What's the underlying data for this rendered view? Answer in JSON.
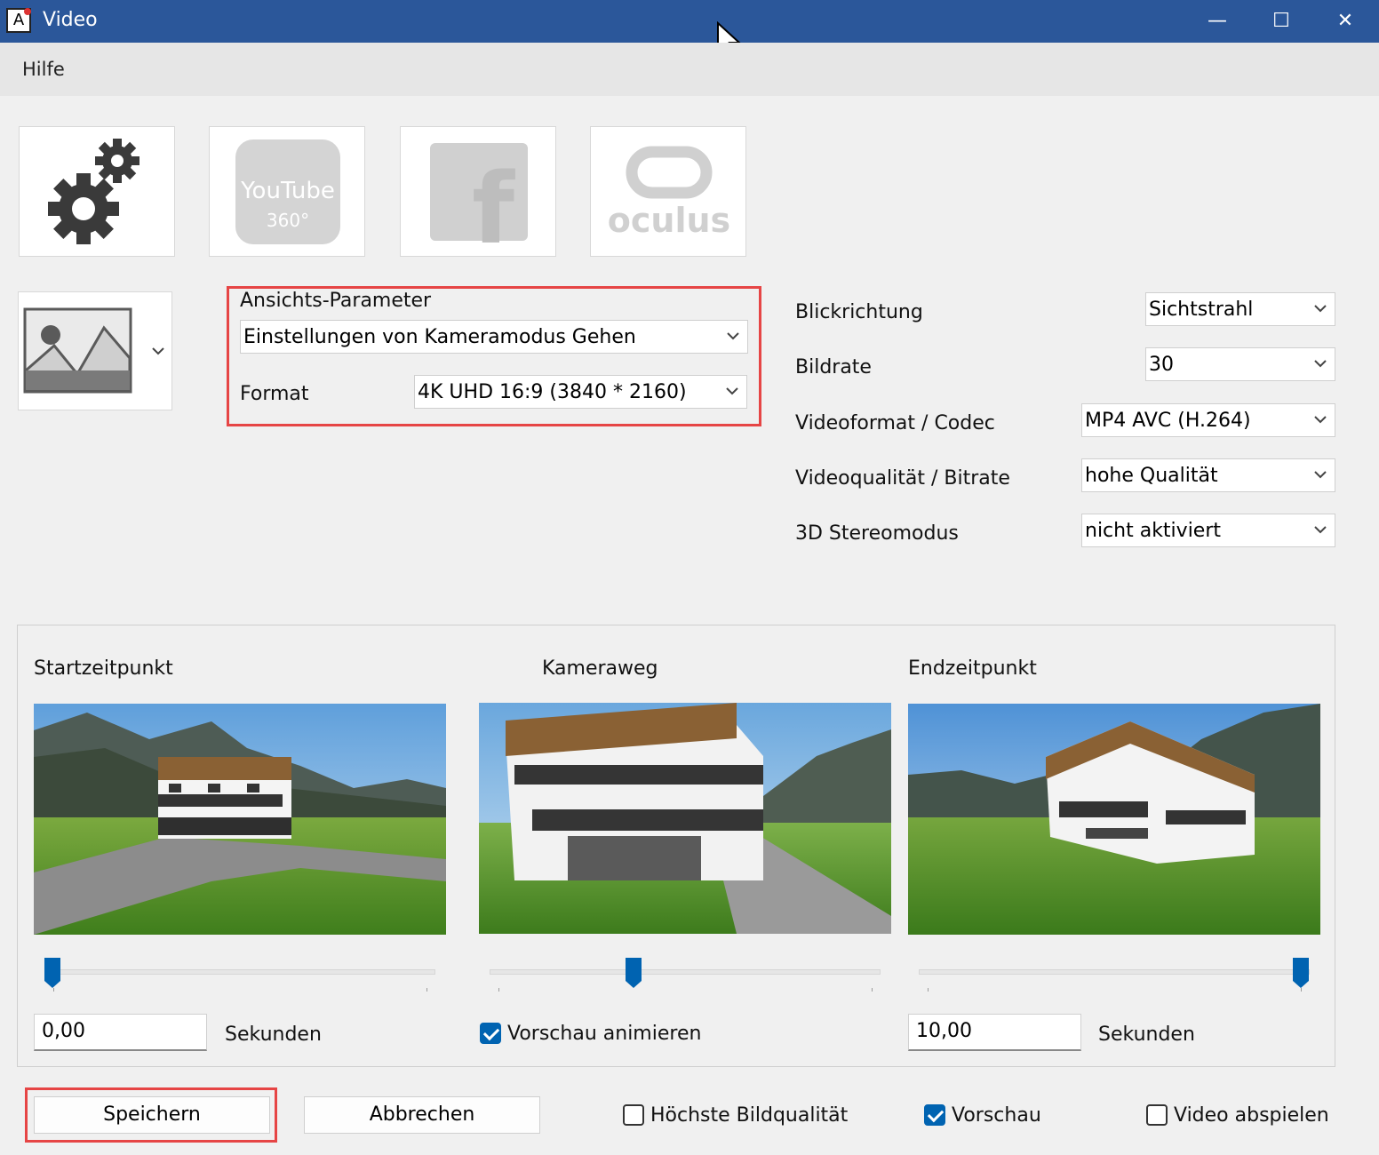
{
  "window": {
    "title": "Video",
    "app_icon_letter": "A",
    "minimize_glyph": "—",
    "maximize_glyph": "☐",
    "close_glyph": "✕"
  },
  "menu": {
    "items": [
      "Hilfe"
    ]
  },
  "toolbar": {
    "tiles": [
      {
        "name": "settings",
        "icon": "gears-icon"
      },
      {
        "name": "youtube-360",
        "icon": "youtube-360-icon",
        "text_top": "YouTube",
        "text_bottom": "360°"
      },
      {
        "name": "facebook",
        "icon": "facebook-icon",
        "text": "f"
      },
      {
        "name": "oculus",
        "icon": "oculus-icon",
        "text": "oculus"
      }
    ]
  },
  "view_params": {
    "title": "Ansichts-Parameter",
    "preset_value": "Einstellungen von Kameramodus Gehen",
    "format_label": "Format",
    "format_value": "4K UHD 16:9 (3840 * 2160)"
  },
  "settings": [
    {
      "label": "Blickrichtung",
      "value": "Sichtstrahl"
    },
    {
      "label": "Bildrate",
      "value": "30"
    },
    {
      "label": "Videoformat / Codec",
      "value": "MP4 AVC (H.264)"
    },
    {
      "label": "Videoqualität / Bitrate",
      "value": "hohe Qualität"
    },
    {
      "label": "3D Stereomodus",
      "value": "nicht aktiviert"
    }
  ],
  "timeline": {
    "start": {
      "label": "Startzeitpunkt",
      "value": "0,00",
      "unit": "Sekunden",
      "slider_fraction": 0.0
    },
    "path": {
      "label": "Kameraweg",
      "slider_fraction": 0.37,
      "animate_label": "Vorschau animieren",
      "animate_checked": true
    },
    "end": {
      "label": "Endzeitpunkt",
      "value": "10,00",
      "unit": "Sekunden",
      "slider_fraction": 1.0
    }
  },
  "footer": {
    "save_label": "Speichern",
    "cancel_label": "Abbrechen",
    "checkboxes": [
      {
        "label": "Höchste Bildqualität",
        "checked": false
      },
      {
        "label": "Vorschau",
        "checked": true
      },
      {
        "label": "Video abspielen",
        "checked": false
      }
    ]
  },
  "colors": {
    "titlebar": "#2b579a",
    "highlight": "#e64545",
    "accent": "#0063b1"
  }
}
